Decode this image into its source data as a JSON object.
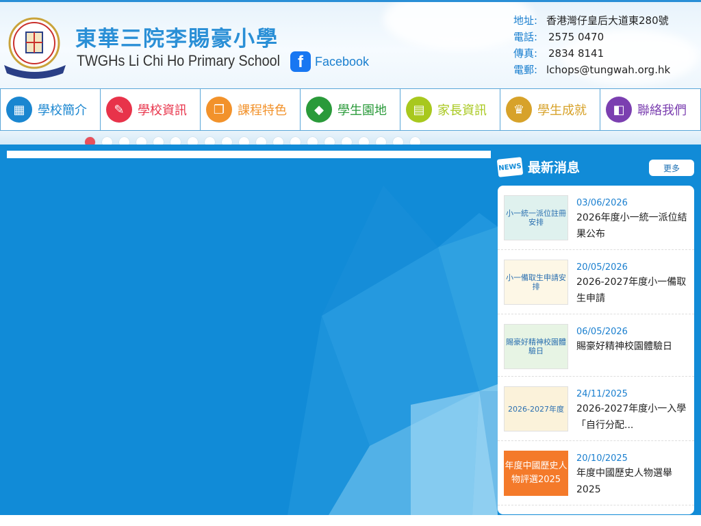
{
  "header": {
    "school_name_cn": "東華三院李賜豪小學",
    "school_name_en": "TWGHs Li Chi Ho Primary School",
    "facebook_label": "Facebook",
    "logo_glyph": "f"
  },
  "contact": [
    {
      "key": "地址:",
      "value": "香港灣仔皇后大道東280號"
    },
    {
      "key": "電話:",
      "value": "2575 0470"
    },
    {
      "key": "傳真:",
      "value": "2834 8141"
    },
    {
      "key": "電郵:",
      "value": "lchops@tungwah.org.hk"
    }
  ],
  "nav": [
    {
      "label": "學校簡介",
      "icon": "school-building-icon",
      "color": "#1a86d0"
    },
    {
      "label": "學校資訊",
      "icon": "document-edit-icon",
      "color": "#e8334a"
    },
    {
      "label": "課程特色",
      "icon": "books-icon",
      "color": "#f2922b"
    },
    {
      "label": "學生園地",
      "icon": "graduation-cap-icon",
      "color": "#2a9a3a"
    },
    {
      "label": "家長資訊",
      "icon": "news-icon",
      "color": "#a8c81e"
    },
    {
      "label": "學生成就",
      "icon": "trophy-icon",
      "color": "#d7a22a"
    },
    {
      "label": "聯絡我們",
      "icon": "contact-card-icon",
      "color": "#7b3fb0"
    }
  ],
  "slider": {
    "dot_count": 20,
    "active_index": 0
  },
  "news": {
    "title": "最新消息",
    "icon_text": "NEWS",
    "more_label": "更多",
    "items": [
      {
        "date": "03/06/2026",
        "text": "2026年度小一統一派位結果公布",
        "thumb_text": "小一統一派位註冊安排",
        "thumb_bg": "#dff1ee"
      },
      {
        "date": "20/05/2026",
        "text": "2026-2027年度小一備取生申請",
        "thumb_text": "小一備取生申請安排",
        "thumb_bg": "#fdf7e6"
      },
      {
        "date": "06/05/2026",
        "text": "賜豪好精神校園體驗日",
        "thumb_text": "賜豪好精神校園體驗日",
        "thumb_bg": "#e7f4e4"
      },
      {
        "date": "24/11/2025",
        "text": "2026-2027年度小一入學「自行分配...",
        "thumb_text": "2026-2027年度",
        "thumb_bg": "#fbf2da"
      },
      {
        "date": "20/10/2025",
        "text": "年度中國歷史人物選舉2025",
        "thumb_text": "年度中國歷史人物評選2025",
        "thumb_bg": "#f47a2a"
      }
    ]
  }
}
